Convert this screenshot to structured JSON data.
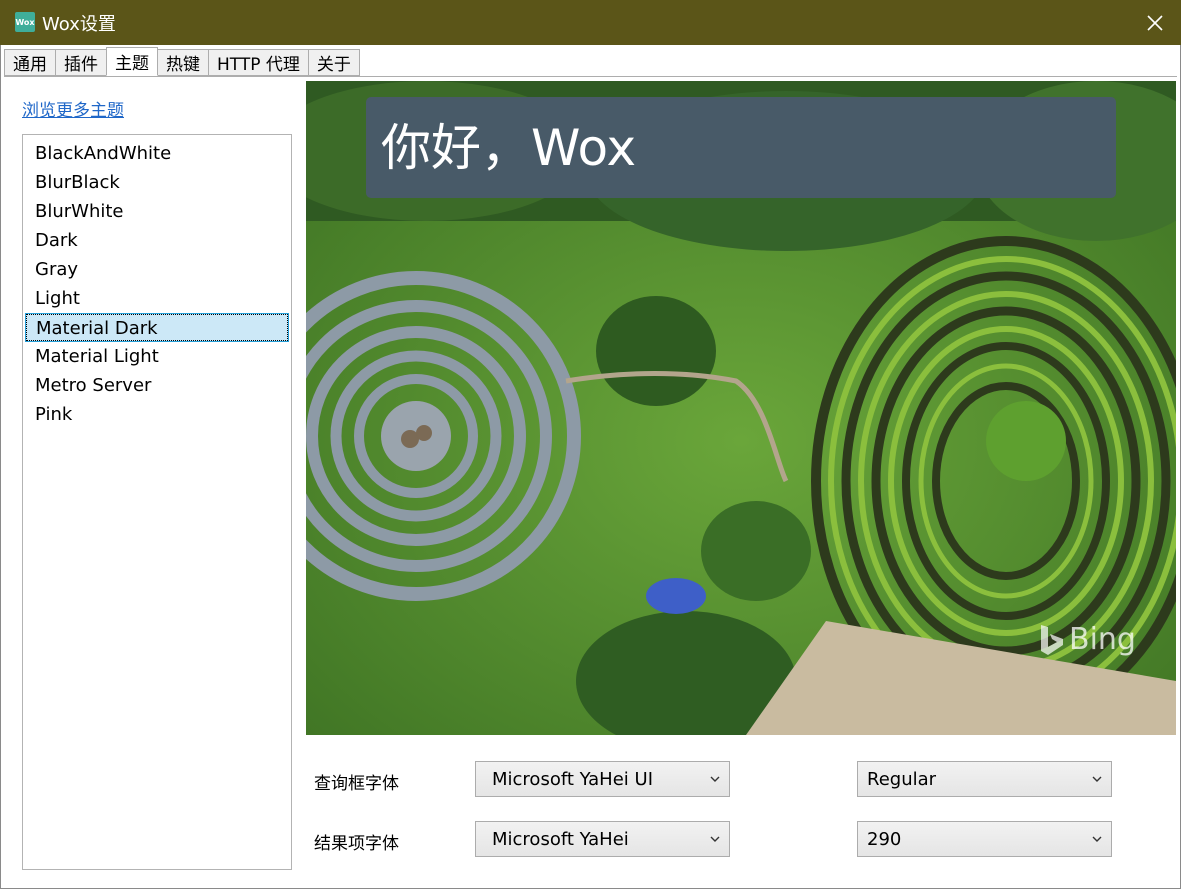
{
  "window": {
    "title": "Wox设置",
    "app_icon_text": "Wox",
    "app_icon_color": "#3fae9a",
    "titlebar_color": "#5b5518"
  },
  "tabs": [
    {
      "label": "通用",
      "active": false
    },
    {
      "label": "插件",
      "active": false
    },
    {
      "label": "主题",
      "active": true
    },
    {
      "label": "热键",
      "active": false
    },
    {
      "label": "HTTP 代理",
      "active": false
    },
    {
      "label": "关于",
      "active": false
    }
  ],
  "theme_panel": {
    "browse_link": "浏览更多主题",
    "themes": [
      {
        "name": "BlackAndWhite"
      },
      {
        "name": "BlurBlack"
      },
      {
        "name": "BlurWhite"
      },
      {
        "name": "Dark"
      },
      {
        "name": "Gray"
      },
      {
        "name": "Light"
      },
      {
        "name": "Material Dark",
        "selected": true
      },
      {
        "name": "Material Light"
      },
      {
        "name": "Metro Server"
      },
      {
        "name": "Pink"
      }
    ]
  },
  "preview": {
    "query_text": "你好，Wox",
    "query_bg_color": "#485a68",
    "watermark": "Bing"
  },
  "fonts": {
    "query": {
      "label": "查询框字体",
      "family": "Microsoft YaHei UI",
      "style": "Regular"
    },
    "result": {
      "label": "结果项字体",
      "family": "Microsoft YaHei",
      "weight": "290"
    }
  }
}
